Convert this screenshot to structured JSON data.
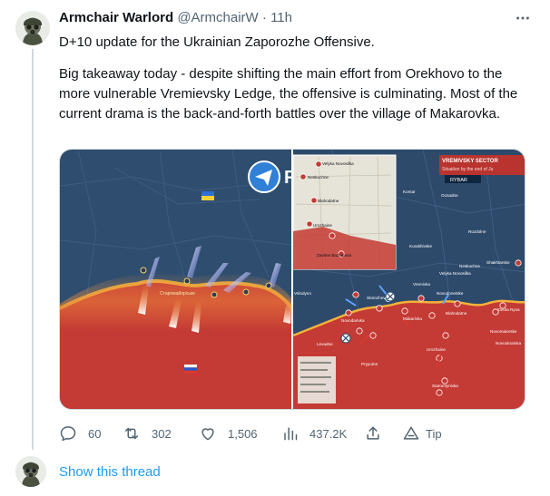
{
  "tweet": {
    "author": {
      "display_name": "Armchair Warlord",
      "handle": "@ArmchairW",
      "separator": "·",
      "time": "11h"
    },
    "more_icon": "more-horizontal-icon",
    "text_paragraphs": [
      "D+10 update for the Ukrainian Zaporozhe Offensive.",
      "Big takeaway today - despite shifting the main effort from Orekhovo to the more vulnerable Vremievsky Ledge, the offensive is culminating.  Most of the current drama is the back-and-forth battles over the village of Makarovka."
    ],
    "media": {
      "brand_mark": "R",
      "sector_title": "VREMIVSKY SECTOR",
      "sector_subtitle": "Situation by the end of Ju",
      "source_tag": "RYBAR",
      "left_map_labels": [
        "Старомайорське"
      ],
      "right_map_labels": [
        "Velyka Novosilka",
        "Neskuchne",
        "Blahodatne",
        "Urozhaine",
        "Zavitne Bazhannia",
        "Volodyno",
        "Storozheve",
        "Vremivka",
        "Novodonetske",
        "Makarivka",
        "Neskuchne",
        "Blahodatne",
        "Urozhaine",
        "Novodarivka",
        "Levadne",
        "Pryyutne",
        "Staromlynivka",
        "Komar",
        "Ocnadne",
        "Rozdolne",
        "Kurakhivske",
        "Shakhtarske",
        "Velyka Novosilka",
        "Zolota Nyva",
        "Novomaiorske",
        "Novoukrainka",
        "Zavitne"
      ],
      "colors": {
        "russian_control": "#c43a34",
        "ukrainian_control": "#2e4a6b",
        "contested": "#e8893a",
        "frontline": "#f2b23a"
      }
    },
    "actions": {
      "replies": {
        "icon": "reply-icon",
        "count": "60"
      },
      "retweets": {
        "icon": "retweet-icon",
        "count": "302"
      },
      "likes": {
        "icon": "heart-icon",
        "count": "1,506"
      },
      "views": {
        "icon": "views-icon",
        "count": "437.2K"
      },
      "share": {
        "icon": "share-icon"
      },
      "tip": {
        "icon": "tip-icon",
        "label": "Tip"
      }
    },
    "show_thread": "Show this thread"
  }
}
